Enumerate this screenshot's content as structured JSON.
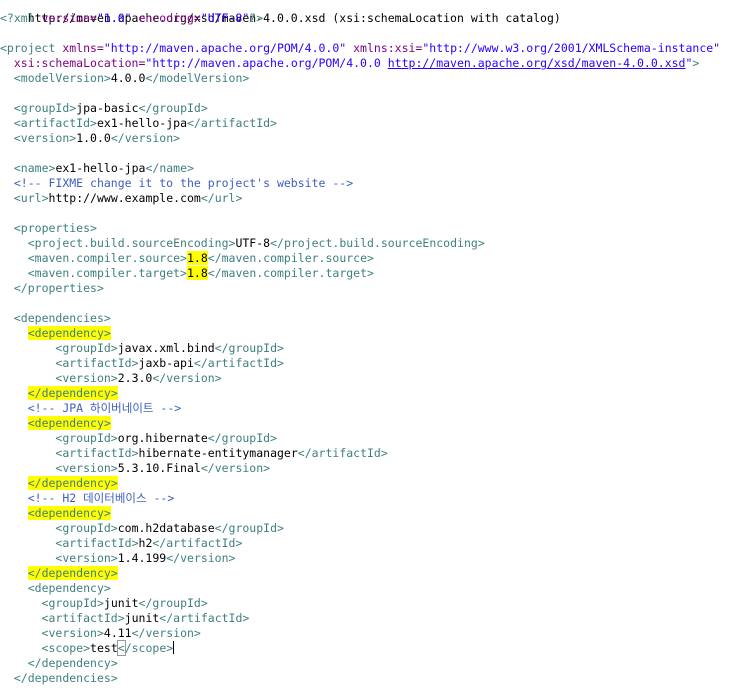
{
  "editor": {
    "line_01": "http://maven.apache.org/xsd/maven-4.0.0.xsd (xsi:schemaLocation with catalog)",
    "xml_decl": {
      "open": "<?xml ",
      "version_attr": "version=",
      "version_val": "\"1.0\"",
      "enc_attr": "encoding=",
      "enc_val": "\"UTF-8\"",
      "close": "?>"
    },
    "project_open": {
      "tag": "<project ",
      "xmlns_attr": "xmlns=",
      "xmlns_val": "\"http://maven.apache.org/POM/4.0.0\"",
      "xsi_attr": "xmlns:xsi=",
      "xsi_val": "\"http://www.w3.org/2001/XMLSchema-instance\""
    },
    "schema_loc": {
      "attr": "xsi:schemaLocation=",
      "val1": "\"http://maven.apache.org/POM/4.0.0 ",
      "val2": "http://maven.apache.org/xsd/maven-4.0.0.xsd",
      "val3": "\"",
      "close": ">"
    },
    "modelVersion": "4.0.0",
    "groupId": "jpa-basic",
    "artifactId": "ex1-hello-jpa",
    "version": "1.0.0",
    "name": "ex1-hello-jpa",
    "comment_fixme": "<!-- FIXME change it to the project's website -->",
    "url": "http://www.example.com",
    "properties": {
      "encoding_tag": "project.build.sourceEncoding",
      "encoding_val": "UTF-8",
      "source_tag": "maven.compiler.source",
      "source_val": "1.8",
      "target_tag": "maven.compiler.target",
      "target_val": "1.8"
    },
    "dependencies": [
      {
        "groupId": "javax.xml.bind",
        "artifactId": "jaxb-api",
        "version": "2.3.0"
      },
      {
        "comment": "<!-- JPA 하이버네이트 -->",
        "groupId": "org.hibernate",
        "artifactId": "hibernate-entitymanager",
        "version": "5.3.10.Final"
      },
      {
        "comment": "<!-- H2 데이터베이스 -->",
        "groupId": "com.h2database",
        "artifactId": "h2",
        "version": "1.4.199"
      },
      {
        "groupId": "junit",
        "artifactId": "junit",
        "version": "4.11",
        "scope": "test"
      }
    ],
    "tags": {
      "project": "project",
      "modelVersion": "modelVersion",
      "groupId": "groupId",
      "artifactId": "artifactId",
      "version": "version",
      "name": "name",
      "url": "url",
      "properties": "properties",
      "dependencies": "dependencies",
      "dependency": "dependency",
      "scope": "scope"
    },
    "colors": {
      "tag": "#3f7f7f",
      "attribute": "#7f007f",
      "string": "#2a00ff",
      "comment": "#3f5fbf",
      "highlight": "#ffff00"
    }
  }
}
